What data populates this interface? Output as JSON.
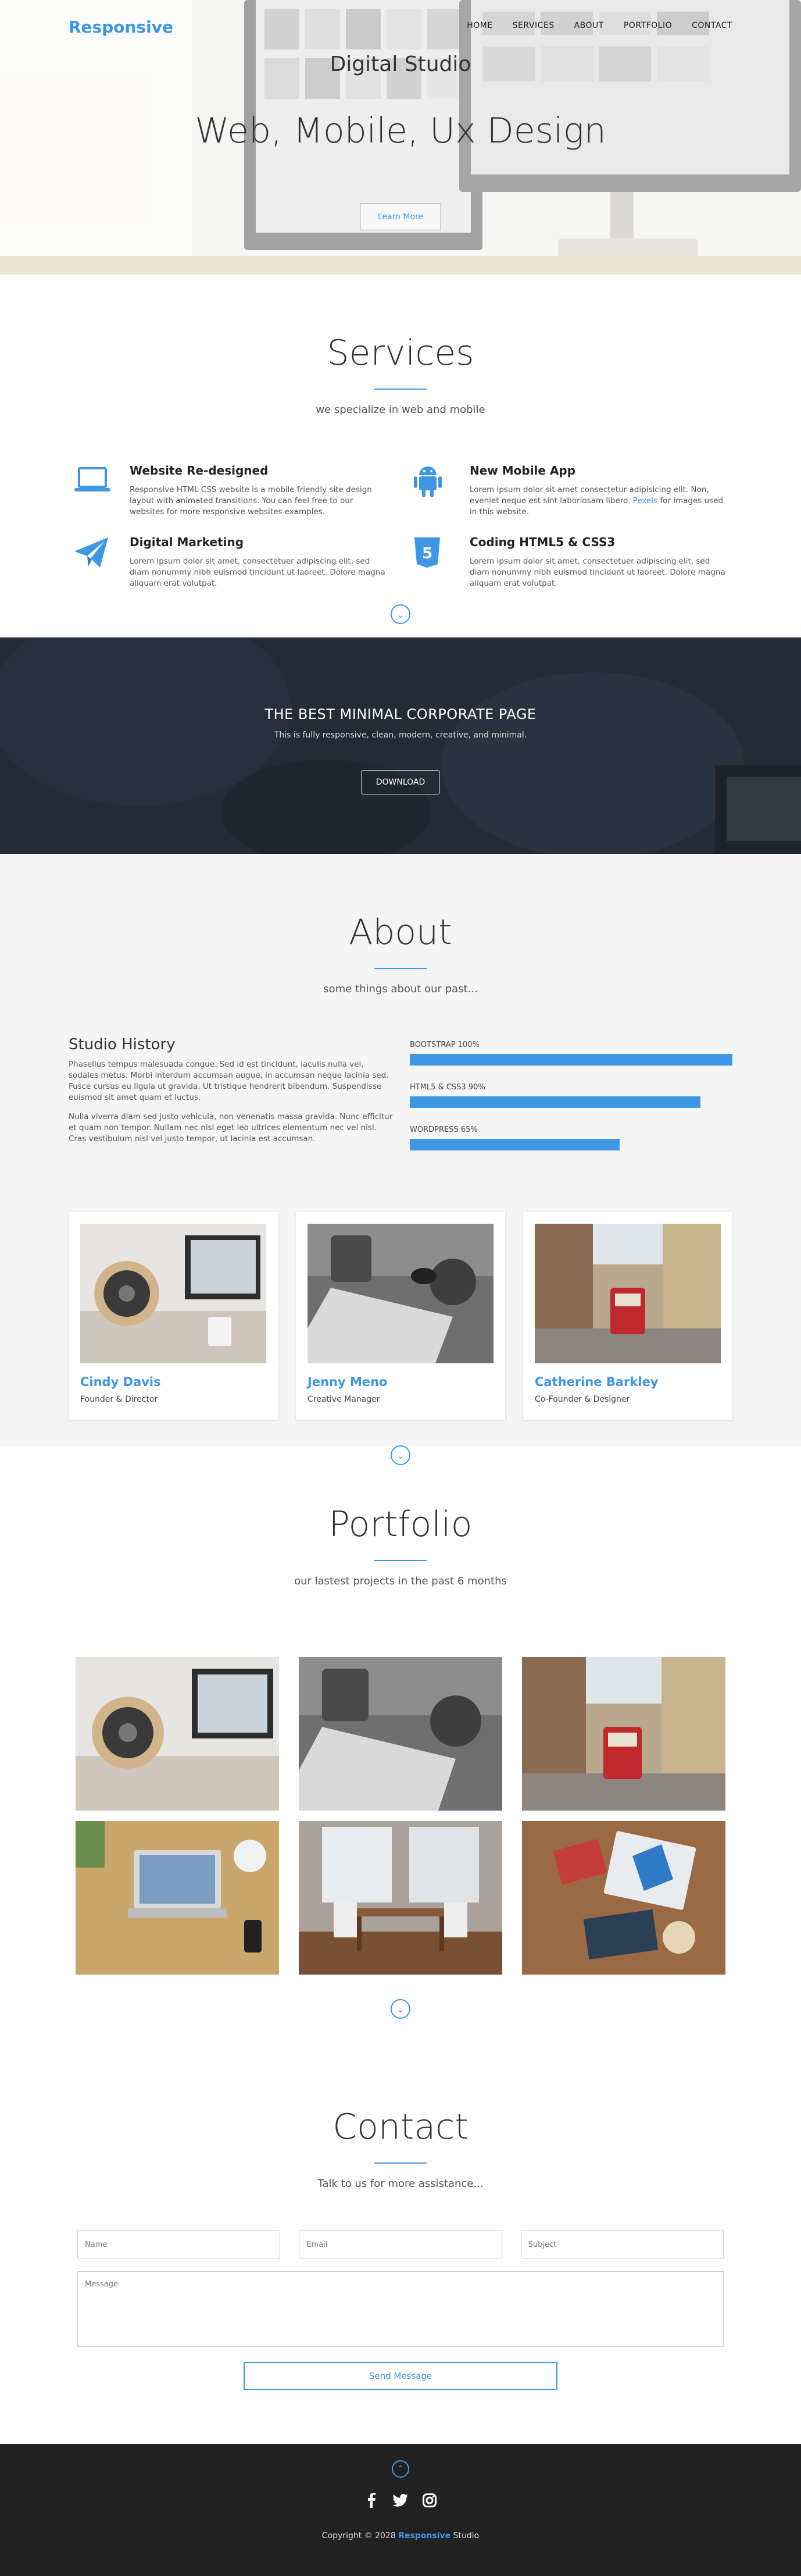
{
  "nav": {
    "brand": "Responsive",
    "items": [
      "HOME",
      "SERVICES",
      "ABOUT",
      "PORTFOLIO",
      "CONTACT"
    ]
  },
  "hero": {
    "subtitle": "Digital Studio",
    "title": "Web, Mobile, Ux Design",
    "button": "Learn More"
  },
  "services": {
    "title": "Services",
    "subtitle": "we specialize in web and mobile",
    "items": [
      {
        "icon": "laptop-icon",
        "title": "Website Re-designed",
        "text": "Responsive HTML CSS website is a mobile friendly site design layout with animated transitions. You can feel free to our websites for more responsive websites examples."
      },
      {
        "icon": "android-icon",
        "title": "New Mobile App",
        "text_before": "Lorem ipsum dolor sit amet consectetur adipisicing elit. Non, eveniet neque est sint laboriosam libero.",
        "link": "Pexels",
        "text_after": "for images used in this website."
      },
      {
        "icon": "paper-plane-icon",
        "title": "Digital Marketing",
        "text": "Lorem ipsum dolor sit amet, consectetuer adipiscing elit, sed diam nonummy nibh euismod tincidunt ut laoreet. Dolore magna aliquam erat volutpat."
      },
      {
        "icon": "html5-icon",
        "title": "Coding HTML5 & CSS3",
        "text": "Lorem ipsum dolor sit amet, consectetuer adipiscing elit, sed diam nonummy nibh euismod tincidunt ut laoreet. Dolore magna aliquam erat volutpat."
      }
    ]
  },
  "banner": {
    "title": "THE BEST MINIMAL CORPORATE PAGE",
    "subtitle": "This is fully responsive, clean, modern, creative, and minimal.",
    "button": "DOWNLOAD"
  },
  "about": {
    "title": "About",
    "subtitle": "some things about our past...",
    "history_title": "Studio History",
    "paragraphs": [
      "Phasellus tempus malesuada congue. Sed id est tincidunt, iaculis nulla vel, sodales metus. Morbi interdum accumsan augue, in accumsan neque lacinia sed. Fusce cursus eu ligula ut gravida. Ut tristique hendrerit bibendum. Suspendisse euismod sit amet quam et luctus.",
      "Nulla viverra diam sed justo vehicula, non venenatis massa gravida. Nunc efficitur et quam non tempor. Nullam nec nisl eget leo ultrices elementum nec vel nisl. Cras vestibulum nisl vel justo tempor, ut lacinia est accumsan."
    ],
    "skills": [
      {
        "label": "BOOTSTRAP 100%",
        "percent": 100
      },
      {
        "label": "HTML5 & CSS3 90%",
        "percent": 90
      },
      {
        "label": "WORDPRESS 65%",
        "percent": 65
      }
    ],
    "team": [
      {
        "name": "Cindy Davis",
        "role": "Founder & Director",
        "photo": "desk-speaker-photo"
      },
      {
        "name": "Jenny Meno",
        "role": "Creative Manager",
        "photo": "keyboard-mouse-photo"
      },
      {
        "name": "Catherine Barkley",
        "role": "Co-Founder & Designer",
        "photo": "tram-street-photo"
      }
    ]
  },
  "portfolio": {
    "title": "Portfolio",
    "subtitle": "our lastest projects in the past 6 months",
    "items": [
      "desk-speaker-photo",
      "keyboard-mouse-photo",
      "tram-street-photo",
      "laptop-desk-photo",
      "dining-room-photo",
      "design-tools-photo"
    ]
  },
  "contact": {
    "title": "Contact",
    "subtitle": "Talk to us for more assistance...",
    "name_placeholder": "Name",
    "email_placeholder": "Email",
    "subject_placeholder": "Subject",
    "message_placeholder": "Message",
    "send": "Send Message"
  },
  "footer": {
    "social_icons": [
      "facebook-icon",
      "twitter-icon",
      "instagram-icon"
    ],
    "copy_before": "Copyright © 2028",
    "copy_brand": "Responsive",
    "copy_after": "Studio"
  },
  "colors": {
    "accent": "#3d97e5",
    "footer": "#222222",
    "about_bg": "#f5f5f5"
  }
}
